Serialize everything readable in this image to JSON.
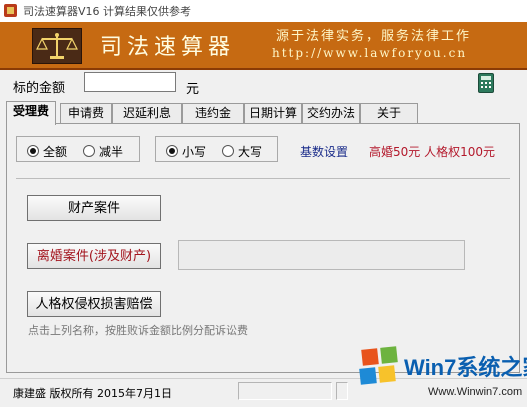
{
  "window": {
    "title": "司法速算器V16  计算结果仅供参考"
  },
  "banner": {
    "title": "司法速算器",
    "slogan": "源于法律实务，服务法律工作",
    "url": "http://www.lawforyou.cn"
  },
  "amount": {
    "label": "标的金额",
    "value": "",
    "unit": "元"
  },
  "tabs": [
    {
      "label": "受理费",
      "active": true
    },
    {
      "label": "申请费",
      "active": false
    },
    {
      "label": "迟延利息",
      "active": false
    },
    {
      "label": "违约金",
      "active": false
    },
    {
      "label": "日期计算",
      "active": false
    },
    {
      "label": "交约办法",
      "active": false
    },
    {
      "label": "关于",
      "active": false
    }
  ],
  "options": {
    "amount_mode": {
      "full": "全额",
      "half": "减半",
      "selected": "full"
    },
    "case_mode": {
      "lower": "小写",
      "upper": "大写",
      "selected": "lower"
    },
    "base_setting": "基数设置",
    "base_info": "高婚50元  人格权100元"
  },
  "cases": {
    "property": "财产案件",
    "divorce": "离婚案件(涉及财产)",
    "personality": "人格权侵权损害赔偿",
    "hint": "点击上列名称，按胜败诉金额比例分配诉讼费"
  },
  "status": {
    "text": "康建盛  版权所有    2015年7月1日"
  },
  "watermark": {
    "brand": "Win7系统之家",
    "url": "Www.Winwin7.com"
  },
  "colors": {
    "banner": "#c66a12",
    "accent_red": "#b3182b",
    "link_blue": "#1a2c8a"
  }
}
